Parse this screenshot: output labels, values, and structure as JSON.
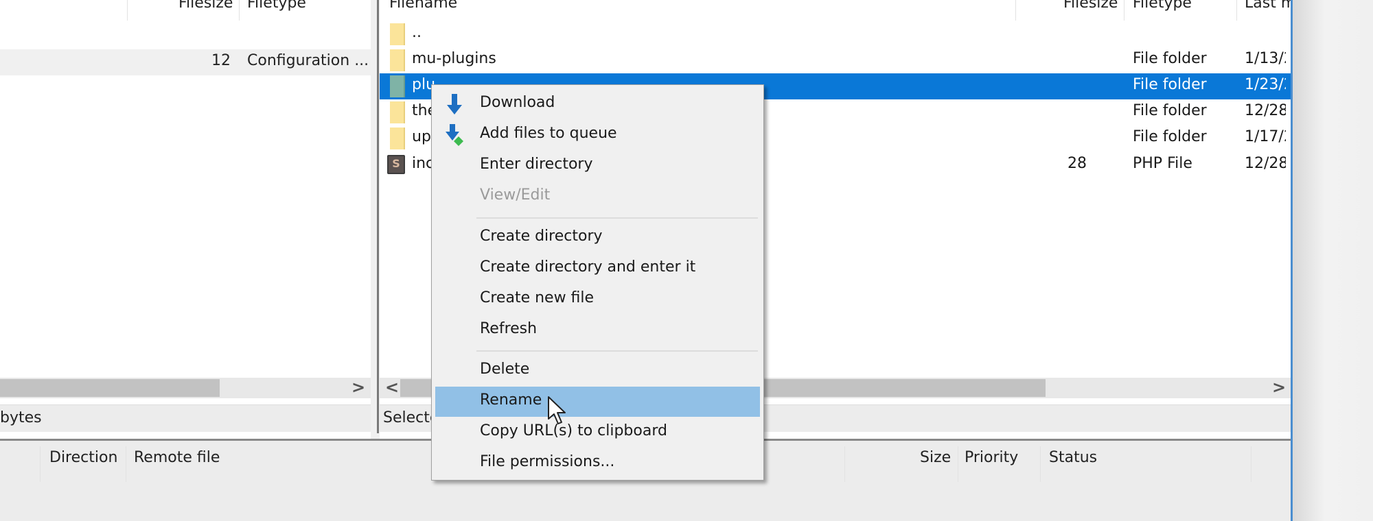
{
  "local_pane": {
    "columns": [
      "Filesize",
      "Filetype"
    ],
    "rows": [
      {
        "filesize": "12",
        "filetype": "Configuration ..."
      }
    ],
    "status_text": "bytes",
    "scroll_right_glyph": ">"
  },
  "remote_pane": {
    "columns": [
      "Filename",
      "Filesize",
      "Filetype",
      "Last m"
    ],
    "rows": [
      {
        "icon": "folder-icon",
        "filename": "..",
        "filesize": "",
        "filetype": "",
        "last_modified": ""
      },
      {
        "icon": "folder-icon",
        "filename": "mu-plugins",
        "filesize": "",
        "filetype": "File folder",
        "last_modified": "1/13/2"
      },
      {
        "icon": "folder-icon",
        "filename": "plu",
        "filesize": "",
        "filetype": "File folder",
        "last_modified": "1/23/2",
        "selected": true
      },
      {
        "icon": "folder-icon",
        "filename": "the",
        "filesize": "",
        "filetype": "File folder",
        "last_modified": "12/28/"
      },
      {
        "icon": "folder-icon",
        "filename": "up",
        "filesize": "",
        "filetype": "File folder",
        "last_modified": "1/17/2"
      },
      {
        "icon": "php-file-icon",
        "filename": "inc",
        "filesize": "28",
        "filetype": "PHP File",
        "last_modified": "12/28/"
      }
    ],
    "status_text": "Selecte",
    "scroll_left_glyph": "<",
    "scroll_right_glyph": ">"
  },
  "queue": {
    "columns": [
      "Direction",
      "Remote file",
      "Size",
      "Priority",
      "Status"
    ]
  },
  "context_menu": {
    "items": [
      {
        "label": "Download",
        "icon": "download-icon"
      },
      {
        "label": "Add files to queue",
        "icon": "add-to-queue-icon"
      },
      {
        "label": "Enter directory"
      },
      {
        "label": "View/Edit",
        "disabled": true
      },
      {
        "label": "Create directory"
      },
      {
        "label": "Create directory and enter it"
      },
      {
        "label": "Create new file"
      },
      {
        "label": "Refresh"
      },
      {
        "label": "Delete"
      },
      {
        "label": "Rename",
        "hovered": true
      },
      {
        "label": "Copy URL(s) to clipboard"
      },
      {
        "label": "File permissions..."
      }
    ]
  },
  "colors": {
    "selection": "#0a78d7",
    "menu_hover": "#91c0e6",
    "folder": "#fbe49a",
    "window_border": "#4a8ed0"
  }
}
